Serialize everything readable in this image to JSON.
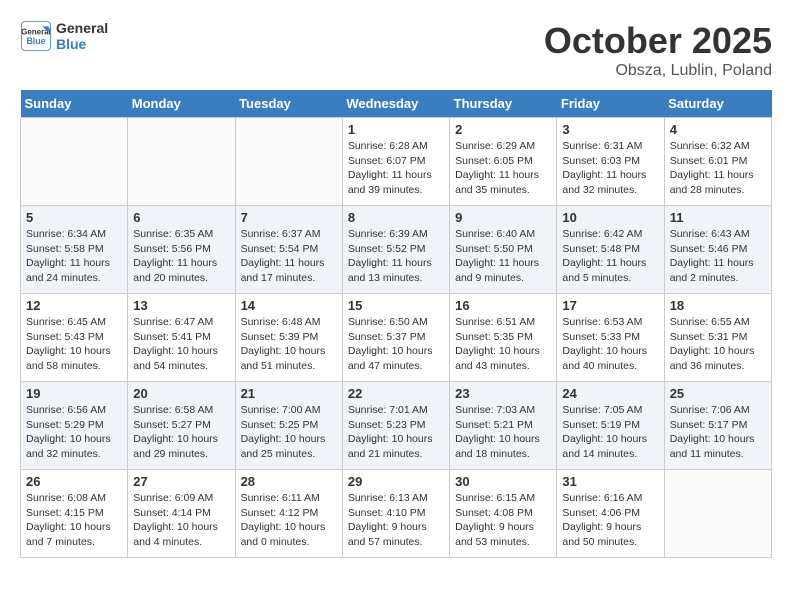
{
  "logo": {
    "line1": "General",
    "line2": "Blue"
  },
  "title": "October 2025",
  "subtitle": "Obsza, Lublin, Poland",
  "days_header": [
    "Sunday",
    "Monday",
    "Tuesday",
    "Wednesday",
    "Thursday",
    "Friday",
    "Saturday"
  ],
  "weeks": [
    [
      {
        "day": "",
        "info": ""
      },
      {
        "day": "",
        "info": ""
      },
      {
        "day": "",
        "info": ""
      },
      {
        "day": "1",
        "info": "Sunrise: 6:28 AM\nSunset: 6:07 PM\nDaylight: 11 hours\nand 39 minutes."
      },
      {
        "day": "2",
        "info": "Sunrise: 6:29 AM\nSunset: 6:05 PM\nDaylight: 11 hours\nand 35 minutes."
      },
      {
        "day": "3",
        "info": "Sunrise: 6:31 AM\nSunset: 6:03 PM\nDaylight: 11 hours\nand 32 minutes."
      },
      {
        "day": "4",
        "info": "Sunrise: 6:32 AM\nSunset: 6:01 PM\nDaylight: 11 hours\nand 28 minutes."
      }
    ],
    [
      {
        "day": "5",
        "info": "Sunrise: 6:34 AM\nSunset: 5:58 PM\nDaylight: 11 hours\nand 24 minutes."
      },
      {
        "day": "6",
        "info": "Sunrise: 6:35 AM\nSunset: 5:56 PM\nDaylight: 11 hours\nand 20 minutes."
      },
      {
        "day": "7",
        "info": "Sunrise: 6:37 AM\nSunset: 5:54 PM\nDaylight: 11 hours\nand 17 minutes."
      },
      {
        "day": "8",
        "info": "Sunrise: 6:39 AM\nSunset: 5:52 PM\nDaylight: 11 hours\nand 13 minutes."
      },
      {
        "day": "9",
        "info": "Sunrise: 6:40 AM\nSunset: 5:50 PM\nDaylight: 11 hours\nand 9 minutes."
      },
      {
        "day": "10",
        "info": "Sunrise: 6:42 AM\nSunset: 5:48 PM\nDaylight: 11 hours\nand 5 minutes."
      },
      {
        "day": "11",
        "info": "Sunrise: 6:43 AM\nSunset: 5:46 PM\nDaylight: 11 hours\nand 2 minutes."
      }
    ],
    [
      {
        "day": "12",
        "info": "Sunrise: 6:45 AM\nSunset: 5:43 PM\nDaylight: 10 hours\nand 58 minutes."
      },
      {
        "day": "13",
        "info": "Sunrise: 6:47 AM\nSunset: 5:41 PM\nDaylight: 10 hours\nand 54 minutes."
      },
      {
        "day": "14",
        "info": "Sunrise: 6:48 AM\nSunset: 5:39 PM\nDaylight: 10 hours\nand 51 minutes."
      },
      {
        "day": "15",
        "info": "Sunrise: 6:50 AM\nSunset: 5:37 PM\nDaylight: 10 hours\nand 47 minutes."
      },
      {
        "day": "16",
        "info": "Sunrise: 6:51 AM\nSunset: 5:35 PM\nDaylight: 10 hours\nand 43 minutes."
      },
      {
        "day": "17",
        "info": "Sunrise: 6:53 AM\nSunset: 5:33 PM\nDaylight: 10 hours\nand 40 minutes."
      },
      {
        "day": "18",
        "info": "Sunrise: 6:55 AM\nSunset: 5:31 PM\nDaylight: 10 hours\nand 36 minutes."
      }
    ],
    [
      {
        "day": "19",
        "info": "Sunrise: 6:56 AM\nSunset: 5:29 PM\nDaylight: 10 hours\nand 32 minutes."
      },
      {
        "day": "20",
        "info": "Sunrise: 6:58 AM\nSunset: 5:27 PM\nDaylight: 10 hours\nand 29 minutes."
      },
      {
        "day": "21",
        "info": "Sunrise: 7:00 AM\nSunset: 5:25 PM\nDaylight: 10 hours\nand 25 minutes."
      },
      {
        "day": "22",
        "info": "Sunrise: 7:01 AM\nSunset: 5:23 PM\nDaylight: 10 hours\nand 21 minutes."
      },
      {
        "day": "23",
        "info": "Sunrise: 7:03 AM\nSunset: 5:21 PM\nDaylight: 10 hours\nand 18 minutes."
      },
      {
        "day": "24",
        "info": "Sunrise: 7:05 AM\nSunset: 5:19 PM\nDaylight: 10 hours\nand 14 minutes."
      },
      {
        "day": "25",
        "info": "Sunrise: 7:06 AM\nSunset: 5:17 PM\nDaylight: 10 hours\nand 11 minutes."
      }
    ],
    [
      {
        "day": "26",
        "info": "Sunrise: 6:08 AM\nSunset: 4:15 PM\nDaylight: 10 hours\nand 7 minutes."
      },
      {
        "day": "27",
        "info": "Sunrise: 6:09 AM\nSunset: 4:14 PM\nDaylight: 10 hours\nand 4 minutes."
      },
      {
        "day": "28",
        "info": "Sunrise: 6:11 AM\nSunset: 4:12 PM\nDaylight: 10 hours\nand 0 minutes."
      },
      {
        "day": "29",
        "info": "Sunrise: 6:13 AM\nSunset: 4:10 PM\nDaylight: 9 hours\nand 57 minutes."
      },
      {
        "day": "30",
        "info": "Sunrise: 6:15 AM\nSunset: 4:08 PM\nDaylight: 9 hours\nand 53 minutes."
      },
      {
        "day": "31",
        "info": "Sunrise: 6:16 AM\nSunset: 4:06 PM\nDaylight: 9 hours\nand 50 minutes."
      },
      {
        "day": "",
        "info": ""
      }
    ]
  ]
}
